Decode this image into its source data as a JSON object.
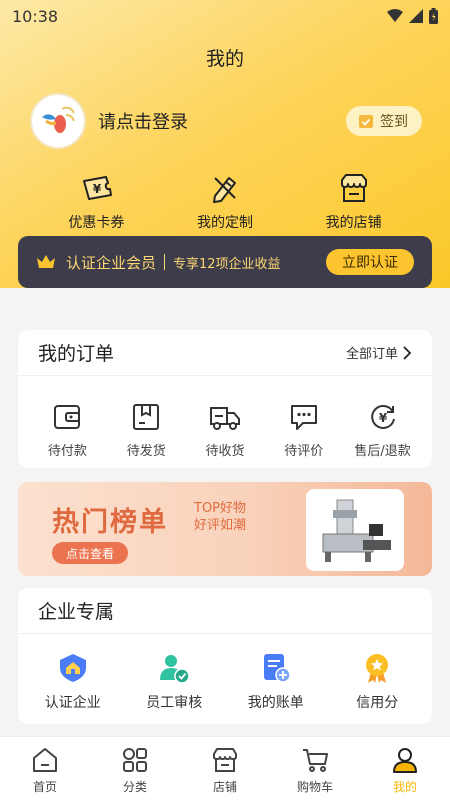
{
  "status": {
    "time": "10:38"
  },
  "title": "我的",
  "profile": {
    "login_text": "请点击登录",
    "signin_label": "签到"
  },
  "quick_actions": [
    {
      "icon": "coupon-card-icon",
      "label": "优惠卡券"
    },
    {
      "icon": "custom-edit-icon",
      "label": "我的定制"
    },
    {
      "icon": "shop-icon",
      "label": "我的店铺"
    }
  ],
  "member": {
    "title": "认证企业会员",
    "desc": "专享12项企业收益",
    "button": "立即认证"
  },
  "orders": {
    "title": "我的订单",
    "all_label": "全部订单",
    "items": [
      {
        "icon": "wallet-icon",
        "label": "待付款"
      },
      {
        "icon": "package-icon",
        "label": "待发货"
      },
      {
        "icon": "truck-icon",
        "label": "待收货"
      },
      {
        "icon": "chat-dots-icon",
        "label": "待评价"
      },
      {
        "icon": "refund-icon",
        "label": "售后/退款"
      }
    ]
  },
  "banner": {
    "title": "热门榜单",
    "sub_line1": "TOP好物",
    "sub_line2": "好评如潮",
    "button": "点击查看"
  },
  "enterprise": {
    "title": "企业专属",
    "items": [
      {
        "icon": "certified-home-icon",
        "label": "认证企业"
      },
      {
        "icon": "staff-review-icon",
        "label": "员工审核"
      },
      {
        "icon": "bill-icon",
        "label": "我的账单"
      },
      {
        "icon": "credit-medal-icon",
        "label": "信用分"
      }
    ]
  },
  "tabbar": [
    {
      "icon": "home-icon",
      "label": "首页",
      "active": false
    },
    {
      "icon": "category-grid-icon",
      "label": "分类",
      "active": false
    },
    {
      "icon": "store-icon",
      "label": "店铺",
      "active": false
    },
    {
      "icon": "cart-icon",
      "label": "购物车",
      "active": false
    },
    {
      "icon": "user-icon",
      "label": "我的",
      "active": true
    }
  ],
  "colors": {
    "brand": "#fcc42f",
    "dark_bar": "#3d3c4a",
    "banner_accent": "#e06a3f",
    "active_tab": "#f7b500"
  }
}
